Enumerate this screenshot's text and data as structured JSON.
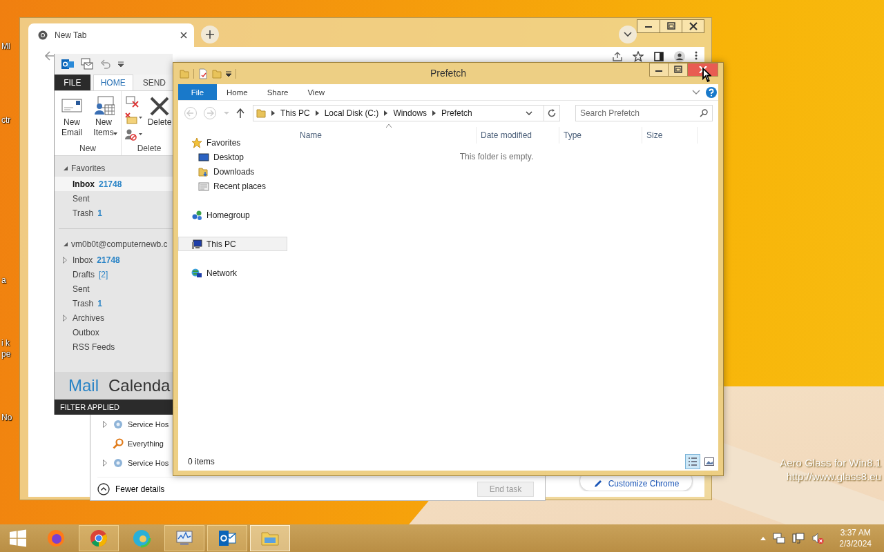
{
  "desktop": {
    "icon_labels": [
      "Ml",
      "ctr",
      "a",
      "i k",
      "pe",
      "No"
    ],
    "watermark_lines": [
      "Aero Glass for Win8.1",
      "http://www.glass8.eu"
    ]
  },
  "chrome": {
    "tab": {
      "title": "New Tab",
      "selected": true
    },
    "customize_button": "Customize Chrome"
  },
  "task_manager": {
    "processes": [
      {
        "name": "Service Hos",
        "kind": "service",
        "expandable": true
      },
      {
        "name": "Everything",
        "kind": "search",
        "expandable": false
      },
      {
        "name": "Service Hos",
        "kind": "service",
        "expandable": true
      }
    ],
    "fewer_details": "Fewer details",
    "end_task": {
      "label": "End task",
      "disabled": true
    }
  },
  "outlook": {
    "tabs": [
      {
        "label": "FILE",
        "kind": "file",
        "selected": false
      },
      {
        "label": "HOME",
        "kind": "tab",
        "selected": true
      },
      {
        "label": "SEND",
        "kind": "tab",
        "selected": false
      }
    ],
    "ribbon_groups": [
      {
        "label": "New",
        "buttons": [
          {
            "label": "New Email",
            "kind": "email",
            "dropdown": false
          },
          {
            "label": "New Items",
            "kind": "items",
            "dropdown": true
          }
        ]
      },
      {
        "label": "Delete",
        "buttons": [
          {
            "label": "Delete",
            "kind": "delete",
            "dropdown": false
          }
        ]
      }
    ],
    "favorites": {
      "title": "Favorites",
      "expanded": true,
      "folders": [
        {
          "name": "Inbox",
          "count": "21748",
          "count_bold": true,
          "expandable": false,
          "selected": true
        },
        {
          "name": "Sent",
          "expandable": false,
          "selected": false
        },
        {
          "name": "Trash",
          "count": "1",
          "count_bold": true,
          "expandable": false,
          "selected": false
        }
      ]
    },
    "account": {
      "title": "vm0b0t@computernewb.c",
      "expanded": true,
      "folders": [
        {
          "name": "Inbox",
          "count": "21748",
          "count_bold": true,
          "expandable": true,
          "selected": false
        },
        {
          "name": "Drafts",
          "count": "[2]",
          "count_bold": false,
          "expandable": false,
          "selected": false
        },
        {
          "name": "Sent",
          "expandable": false,
          "selected": false
        },
        {
          "name": "Trash",
          "count": "1",
          "count_bold": true,
          "expandable": false,
          "selected": false
        },
        {
          "name": "Archives",
          "expandable": true,
          "selected": false
        },
        {
          "name": "Outbox",
          "expandable": false,
          "selected": false
        },
        {
          "name": "RSS Feeds",
          "expandable": false,
          "selected": false
        }
      ]
    },
    "nav": [
      {
        "label": "Mail",
        "selected": true
      },
      {
        "label": "Calenda",
        "selected": false
      }
    ],
    "status": "FILTER APPLIED"
  },
  "explorer": {
    "title": "Prefetch",
    "close_hovered": true,
    "tabs": [
      {
        "label": "File",
        "kind": "file",
        "selected": false
      },
      {
        "label": "Home",
        "kind": "tab",
        "selected": false
      },
      {
        "label": "Share",
        "kind": "tab",
        "selected": false
      },
      {
        "label": "View",
        "kind": "tab",
        "selected": false
      }
    ],
    "breadcrumb": [
      "This PC",
      "Local Disk (C:)",
      "Windows",
      "Prefetch"
    ],
    "search": {
      "placeholder": "Search Prefetch"
    },
    "nav": [
      {
        "label": "Favorites",
        "kind": "star",
        "selected": false,
        "children": [
          {
            "label": "Desktop",
            "kind": "desktop",
            "selected": false
          },
          {
            "label": "Downloads",
            "kind": "downloads",
            "selected": false
          },
          {
            "label": "Recent places",
            "kind": "recent",
            "selected": false
          }
        ]
      },
      {
        "label": "Homegroup",
        "kind": "homegroup",
        "selected": false
      },
      {
        "label": "This PC",
        "kind": "pc",
        "selected": true
      },
      {
        "label": "Network",
        "kind": "network",
        "selected": false
      }
    ],
    "columns": [
      {
        "label": "Name",
        "sorted": true
      },
      {
        "label": "Date modified",
        "sorted": false
      },
      {
        "label": "Type",
        "sorted": false
      },
      {
        "label": "Size",
        "sorted": false
      }
    ],
    "empty_message": "This folder is empty.",
    "status": "0 items",
    "views": [
      {
        "kind": "details",
        "selected": true
      },
      {
        "kind": "thumbnails",
        "selected": false
      }
    ]
  },
  "taskbar": {
    "apps": [
      {
        "kind": "firefox",
        "running": false,
        "selected": false
      },
      {
        "kind": "chrome",
        "running": true,
        "selected": false
      },
      {
        "kind": "edge",
        "running": false,
        "selected": false
      },
      {
        "kind": "monitor",
        "running": true,
        "selected": false
      },
      {
        "kind": "outlook",
        "running": true,
        "selected": false
      },
      {
        "kind": "explorer",
        "running": true,
        "selected": true
      }
    ],
    "time": "3:37 AM",
    "date": "2/3/2024"
  }
}
